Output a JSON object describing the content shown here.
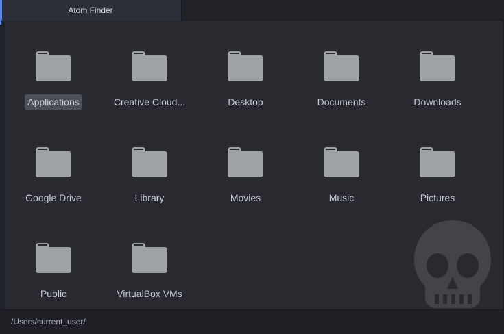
{
  "window": {
    "tab_title": "Atom Finder"
  },
  "colors": {
    "accent": "#568af2",
    "background": "#282a2f",
    "folder": "#9ea1a6",
    "selection": "#4d5057"
  },
  "entries": [
    {
      "label": "Applications",
      "icon": "folder-icon",
      "selected": true
    },
    {
      "label": "Creative Cloud...",
      "icon": "folder-icon",
      "selected": false
    },
    {
      "label": "Desktop",
      "icon": "folder-icon",
      "selected": false
    },
    {
      "label": "Documents",
      "icon": "folder-icon",
      "selected": false
    },
    {
      "label": "Downloads",
      "icon": "folder-icon",
      "selected": false
    },
    {
      "label": "Google Drive",
      "icon": "folder-icon",
      "selected": false
    },
    {
      "label": "Library",
      "icon": "folder-icon",
      "selected": false
    },
    {
      "label": "Movies",
      "icon": "folder-icon",
      "selected": false
    },
    {
      "label": "Music",
      "icon": "folder-icon",
      "selected": false
    },
    {
      "label": "Pictures",
      "icon": "folder-icon",
      "selected": false
    },
    {
      "label": "Public",
      "icon": "folder-icon",
      "selected": false
    },
    {
      "label": "VirtualBox VMs",
      "icon": "folder-icon",
      "selected": false
    }
  ],
  "status": {
    "path": "/Users/current_user/"
  },
  "watermark": {
    "icon": "skull-icon"
  }
}
